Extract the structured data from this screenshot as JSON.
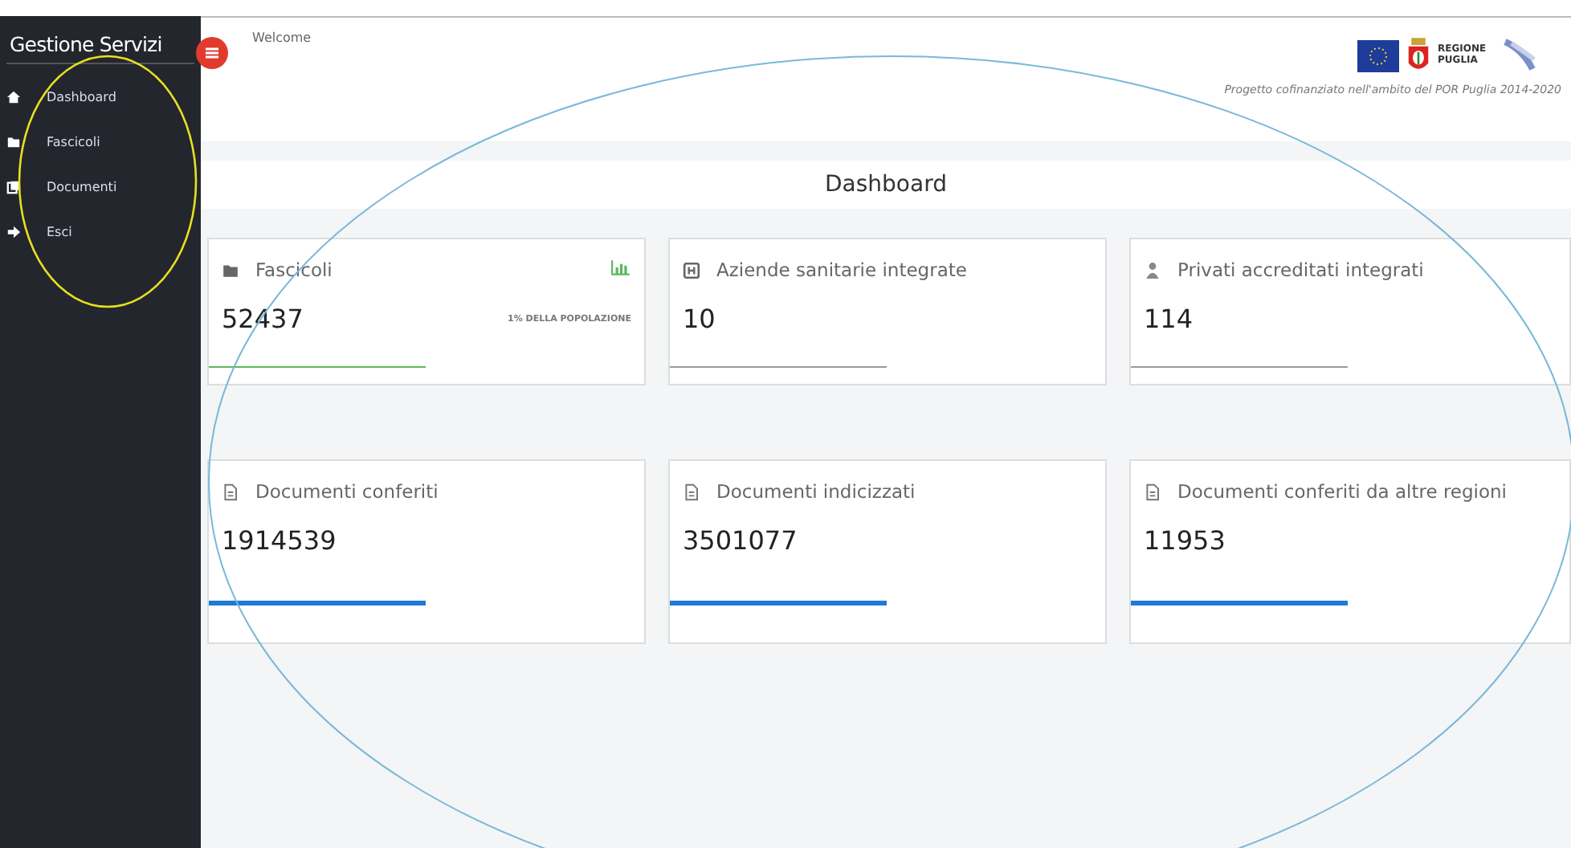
{
  "sidebar": {
    "title": "Gestione Servizi",
    "items": [
      {
        "label": "Dashboard"
      },
      {
        "label": "Fascicoli"
      },
      {
        "label": "Documenti"
      },
      {
        "label": "Esci"
      }
    ]
  },
  "header": {
    "welcome": "Welcome",
    "logo_text": "REGIONE PUGLIA",
    "caption": "Progetto cofinanziato nell'ambito del POR Puglia 2014-2020"
  },
  "page_title": "Dashboard",
  "cards": [
    {
      "title": "Fascicoli",
      "value": "52437",
      "note": "1% DELLA POPOLAZIONE",
      "color": "#5cb85c"
    },
    {
      "title": "Aziende sanitarie integrate",
      "value": "10",
      "color": "#9a9a9a"
    },
    {
      "title": "Privati accreditati integrati",
      "value": "114",
      "color": "#9a9a9a"
    },
    {
      "title": "Documenti conferiti",
      "value": "1914539",
      "color": "#1e7ad6"
    },
    {
      "title": "Documenti indicizzati",
      "value": "3501077",
      "color": "#1e7ad6"
    },
    {
      "title": "Documenti conferiti da altre regioni",
      "value": "11953",
      "color": "#1e7ad6"
    }
  ]
}
